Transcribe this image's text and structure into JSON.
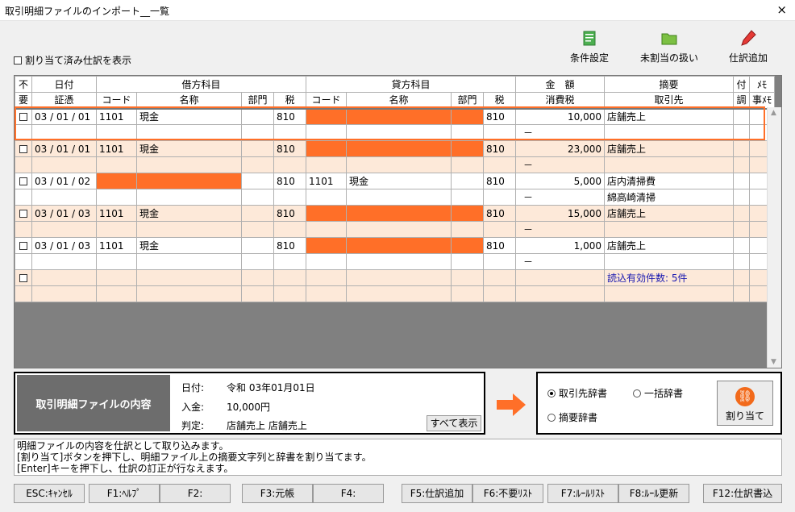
{
  "window": {
    "title": "取引明細ファイルのインポート__一覧",
    "close": "×"
  },
  "options": {
    "show_assigned": "割り当て済み仕訳を表示"
  },
  "toolbar": {
    "conditions": "条件設定",
    "unassigned": "未割当の扱い",
    "add_journal": "仕訳追加"
  },
  "header": {
    "row1": {
      "unneeded1": "不",
      "date": "日付",
      "debit": "借方科目",
      "credit": "貸方科目",
      "amount": "金　額",
      "summary": "摘要",
      "attach": "付",
      "memo": "ﾒﾓ"
    },
    "row2": {
      "unneeded2": "要",
      "voucher": "証憑",
      "code": "コード",
      "name": "名称",
      "dept": "部門",
      "tax": "税",
      "code2": "コード",
      "name2": "名称",
      "dept2": "部門",
      "tax2": "税",
      "ctax": "消費税",
      "partner": "取引先",
      "adj": "調",
      "memo2": "事ﾒﾓ"
    }
  },
  "rows": [
    {
      "date": "03 / 01 / 01",
      "dcode": "1101",
      "dname": "現金",
      "dtax": "810",
      "ccode": "",
      "cname": "",
      "ctax": "810",
      "amount": "10,000",
      "summary": "店舗売上",
      "dash": "－",
      "partner": ""
    },
    {
      "date": "03 / 01 / 01",
      "dcode": "1101",
      "dname": "現金",
      "dtax": "810",
      "ccode": "",
      "cname": "",
      "ctax": "810",
      "amount": "23,000",
      "summary": "店舗売上",
      "dash": "－",
      "partner": ""
    },
    {
      "date": "03 / 01 / 02",
      "dcode": "",
      "dname": "",
      "dtax": "810",
      "ccode": "1101",
      "cname": "現金",
      "ctax": "810",
      "amount": "5,000",
      "summary": "店内清掃費",
      "dash": "－",
      "partner": "綿高崎清掃"
    },
    {
      "date": "03 / 01 / 03",
      "dcode": "1101",
      "dname": "現金",
      "dtax": "810",
      "ccode": "",
      "cname": "",
      "ctax": "810",
      "amount": "15,000",
      "summary": "店舗売上",
      "dash": "－",
      "partner": ""
    },
    {
      "date": "03 / 01 / 03",
      "dcode": "1101",
      "dname": "現金",
      "dtax": "810",
      "ccode": "",
      "cname": "",
      "ctax": "810",
      "amount": "1,000",
      "summary": "店舗売上",
      "dash": "－",
      "partner": ""
    }
  ],
  "count_text": "読込有効件数: 5件",
  "detail": {
    "heading": "取引明細ファイルの内容",
    "date_label": "日付:",
    "date_value": "令和 03年01月01日",
    "deposit_label": "入金:",
    "deposit_value": "10,000円",
    "judge_label": "判定:",
    "judge_value": "店舗売上  店舗売上",
    "show_all": "すべて表示"
  },
  "dictionary": {
    "partner": "取引先辞書",
    "bulk": "一括辞書",
    "summary": "摘要辞書",
    "assign": "割り当て"
  },
  "messages": [
    "明細ファイルの内容を仕訳として取り込みます。",
    "[割り当て]ボタンを押下し、明細ファイル上の摘要文字列と辞書を割り当てます。",
    "[Enter]キーを押下し、仕訳の訂正が行なえます。"
  ],
  "fkeys": [
    "ESC:ｷｬﾝｾﾙ",
    "F1:ﾍﾙﾌﾟ",
    "F2:",
    "F3:元帳",
    "F4:",
    "F5:仕訳追加",
    "F6:不要ﾘｽﾄ",
    "F7:ﾙｰﾙﾘｽﾄ",
    "F8:ﾙｰﾙ更新",
    "F12:仕訳書込"
  ],
  "colors": {
    "accent": "#ff6f28",
    "row_alt": "#fde9d9",
    "count": "#1515b0"
  }
}
